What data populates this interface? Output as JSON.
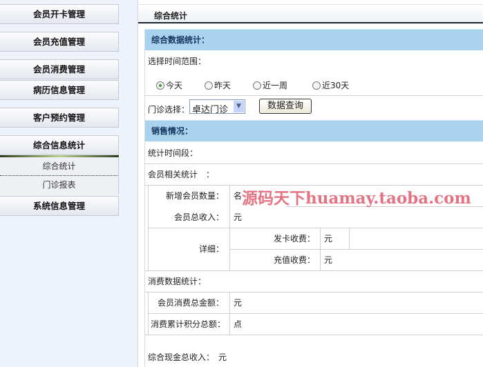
{
  "sidebar": {
    "items": [
      "会员开卡管理",
      "会员充值管理",
      "会员消费管理",
      "病历信息管理",
      "客户预约管理",
      "综合信息统计"
    ],
    "subitems": [
      "综合统计",
      "门诊报表"
    ],
    "last": "系统信息管理"
  },
  "page": {
    "title": "综合统计"
  },
  "section1": {
    "header": "综合数据统计：",
    "range_label": "选择时间范围：",
    "radios": [
      {
        "label": "今天",
        "checked": true
      },
      {
        "label": "昨天",
        "checked": false
      },
      {
        "label": "近一周",
        "checked": false
      },
      {
        "label": "近30天",
        "checked": false
      }
    ],
    "clinic_label": "门诊选择：",
    "clinic_value": "卓达门诊",
    "query_button": "数据查询"
  },
  "section2": {
    "header": "销售情况：",
    "period_label": "统计时间段：",
    "member_stats_label": "会员相关统计　：",
    "new_members_label": "新增会员数量：",
    "new_members_unit": "名",
    "member_income_label": "会员总收入：",
    "member_income_unit": "元",
    "detail_label": "详细：",
    "card_fee_label": "发卡收费：",
    "card_fee_unit": "元",
    "recharge_fee_label": "充值收费：",
    "recharge_fee_unit": "元",
    "consume_label": "消费数据统计：",
    "consume_total_label": "会员消费总金额：",
    "consume_total_unit": "元",
    "points_label": "消费累计积分总额：",
    "points_unit": "点",
    "cash_label": "综合现金总收入：",
    "cash_unit": "元"
  },
  "watermark": "源码天下huamay.taoba.com"
}
